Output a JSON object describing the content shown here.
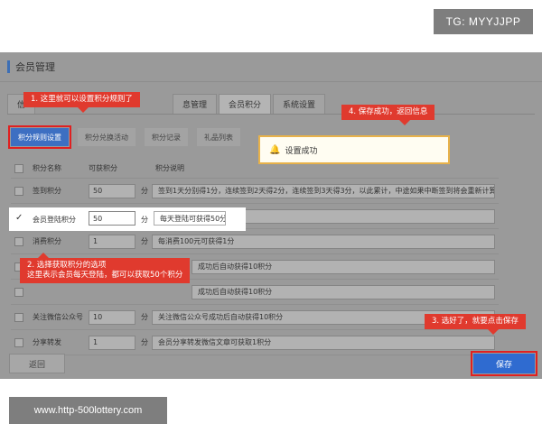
{
  "overlay": {
    "tg": "TG: MYYJJPP",
    "url": "www.http-500lottery.com"
  },
  "page": {
    "title": "会员管理"
  },
  "tabs": [
    {
      "label": "信",
      "active": false
    },
    {
      "label": "息管理",
      "active": false
    },
    {
      "label": "会员积分",
      "active": true
    },
    {
      "label": "系统设置",
      "active": false
    }
  ],
  "subtabs": [
    {
      "label": "积分规则设置",
      "active": true
    },
    {
      "label": "积分兑换活动",
      "active": false
    },
    {
      "label": "积分记录",
      "active": false
    },
    {
      "label": "礼品列表",
      "active": false
    }
  ],
  "table": {
    "headers": {
      "name": "积分名称",
      "points": "可获积分",
      "desc": "积分说明"
    },
    "rows": [
      {
        "name": "签到积分",
        "points": "50",
        "unit": "分",
        "desc": "签到1天分别得1分，连续签到2天得2分，连续签到3天得3分，以此累计，中途如果中断签到将会重新计算",
        "checked": false
      },
      {
        "name": "会员登陆积分",
        "points": "50",
        "unit": "分",
        "desc": "每天登陆可获得50分",
        "checked": true
      },
      {
        "name": "消费积分",
        "points": "1",
        "unit": "分",
        "desc": "每消费100元可获得1分",
        "checked": false
      },
      {
        "name": "",
        "points": "",
        "unit": "",
        "desc": "成功后自动获得10积分",
        "checked": false
      },
      {
        "name": "",
        "points": "",
        "unit": "",
        "desc": "成功后自动获得10积分",
        "checked": false
      },
      {
        "name": "关注微信公众号",
        "points": "10",
        "unit": "分",
        "desc": "关注微信公众号成功后自动获得10积分",
        "checked": false
      },
      {
        "name": "分享转发",
        "points": "1",
        "unit": "分",
        "desc": "会员分享转发微信文章可获取1积分",
        "checked": false
      }
    ]
  },
  "toast": {
    "text": "设置成功"
  },
  "callouts": {
    "c1": "1. 这里就可以设置积分规则了",
    "c2_line1": "2. 选择获取积分的选项",
    "c2_line2": "这里表示会员每天登陆，都可以获取50个积分",
    "c3": "3. 选好了，就要点击保存",
    "c4": "4. 保存成功，返回信息"
  },
  "buttons": {
    "back": "返回",
    "save": "保存"
  },
  "colors": {
    "accent": "#2f6bd0",
    "callout": "#e03a2e",
    "toast_border": "#e8b24a"
  }
}
